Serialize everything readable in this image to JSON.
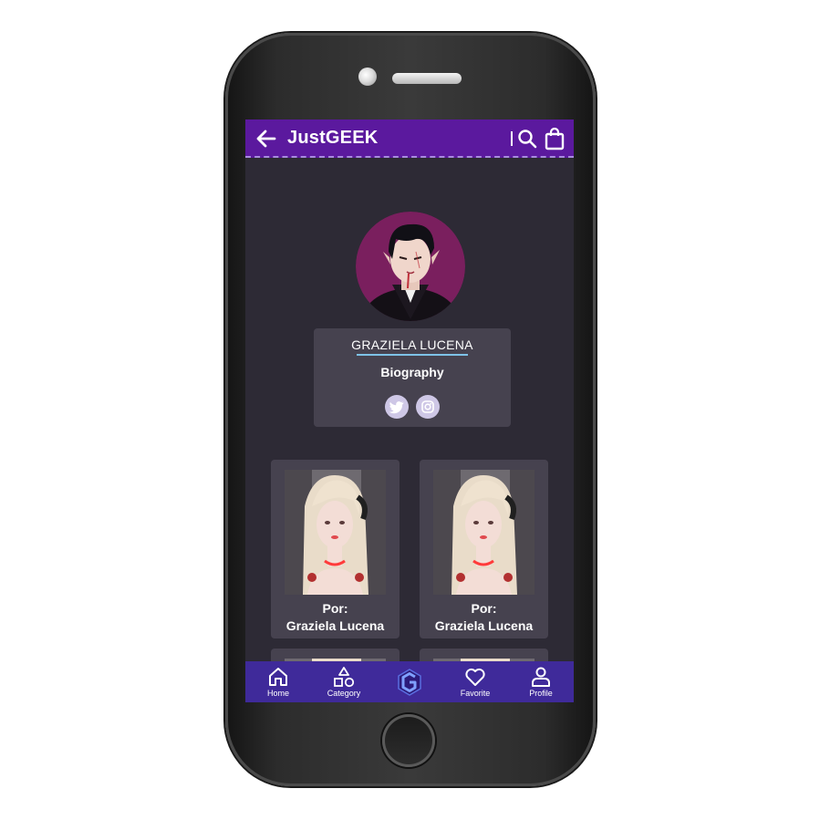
{
  "header": {
    "brand": "JustGEEK",
    "icons": [
      "back-arrow-icon",
      "search-icon",
      "shopping-bag-icon"
    ]
  },
  "profile": {
    "name": "GRAZIELA LUCENA",
    "biography_label": "Biography",
    "socials": [
      "twitter-icon",
      "instagram-icon"
    ]
  },
  "gallery": [
    {
      "by_label": "Por:",
      "author": "Graziela Lucena"
    },
    {
      "by_label": "Por:",
      "author": "Graziela Lucena"
    }
  ],
  "bottom_nav": {
    "items": [
      {
        "label": "Home",
        "icon": "home-icon"
      },
      {
        "label": "Category",
        "icon": "category-icon"
      },
      {
        "label": "",
        "icon": "app-logo-icon"
      },
      {
        "label": "Favorite",
        "icon": "heart-icon"
      },
      {
        "label": "Profile",
        "icon": "user-icon"
      }
    ]
  },
  "colors": {
    "topbar": "#5b199e",
    "screen_bg": "#2d2a35",
    "card_bg": "#46424f",
    "bottom_nav": "#3f2a9a",
    "accent_underline": "#7ec2e8"
  }
}
